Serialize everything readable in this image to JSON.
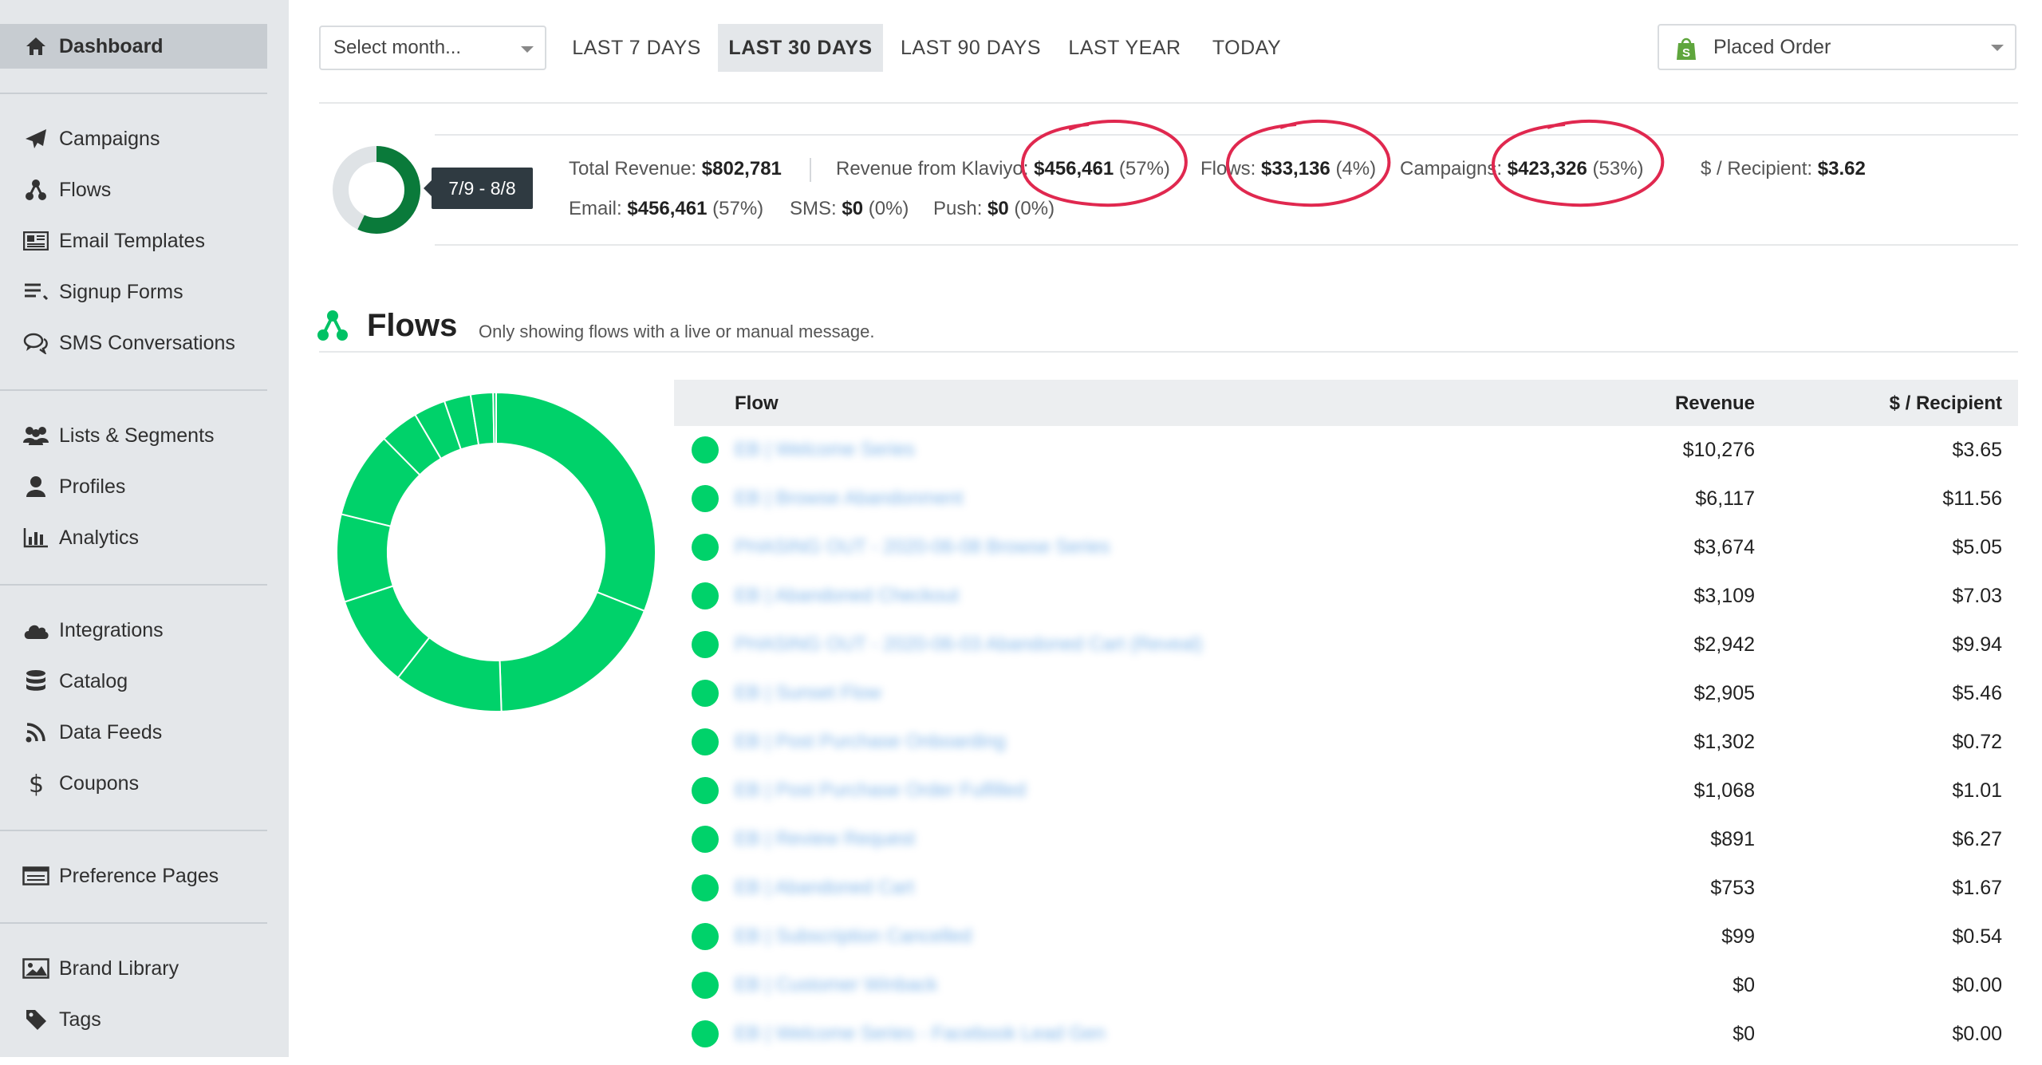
{
  "sidebar": {
    "active": {
      "label": "Dashboard",
      "icon": "home-icon"
    },
    "groups": [
      [
        {
          "label": "Campaigns",
          "icon": "paper-plane-icon"
        },
        {
          "label": "Flows",
          "icon": "flows-icon"
        },
        {
          "label": "Email Templates",
          "icon": "newspaper-icon"
        },
        {
          "label": "Signup Forms",
          "icon": "list-icon"
        },
        {
          "label": "SMS Conversations",
          "icon": "chat-icon"
        }
      ],
      [
        {
          "label": "Lists & Segments",
          "icon": "users-icon"
        },
        {
          "label": "Profiles",
          "icon": "user-icon"
        },
        {
          "label": "Analytics",
          "icon": "bar-chart-icon"
        }
      ],
      [
        {
          "label": "Integrations",
          "icon": "cloud-icon"
        },
        {
          "label": "Catalog",
          "icon": "database-icon"
        },
        {
          "label": "Data Feeds",
          "icon": "rss-icon"
        },
        {
          "label": "Coupons",
          "icon": "dollar-icon"
        }
      ],
      [
        {
          "label": "Preference Pages",
          "icon": "browser-window-icon"
        }
      ],
      [
        {
          "label": "Brand Library",
          "icon": "image-icon"
        },
        {
          "label": "Tags",
          "icon": "tag-icon"
        }
      ]
    ]
  },
  "toolbar": {
    "month_placeholder": "Select month...",
    "ranges": [
      "LAST 7 DAYS",
      "LAST 30 DAYS",
      "LAST 90 DAYS",
      "LAST YEAR",
      "TODAY"
    ],
    "active_range": "LAST 30 DAYS",
    "metric": "Placed Order"
  },
  "summary": {
    "date_range": "7/9 - 8/8",
    "total_revenue_label": "Total Revenue:",
    "total_revenue": "$802,781",
    "klaviyo_label": "Revenue from Klaviyo:",
    "klaviyo_value": "$456,461",
    "klaviyo_pct": "(57%)",
    "flows_label": "Flows:",
    "flows_value": "$33,136",
    "flows_pct": "(4%)",
    "campaigns_label": "Campaigns:",
    "campaigns_value": "$423,326",
    "campaigns_pct": "(53%)",
    "per_recipient_label": "$ / Recipient:",
    "per_recipient": "$3.62",
    "email_label": "Email:",
    "email_value": "$456,461",
    "email_pct": "(57%)",
    "sms_label": "SMS:",
    "sms_value": "$0",
    "sms_pct": "(0%)",
    "push_label": "Push:",
    "push_value": "$0",
    "push_pct": "(0%)",
    "klaviyo_share": 0.57
  },
  "flows_section": {
    "title": "Flows",
    "subtitle": "Only showing flows with a live or manual message.",
    "columns": {
      "flow": "Flow",
      "revenue": "Revenue",
      "per_recipient": "$ / Recipient"
    },
    "rows": [
      {
        "name": "EB | Welcome Series",
        "revenue": "$10,276",
        "per_recipient": "$3.65",
        "value": 10276
      },
      {
        "name": "EB | Browse Abandonment",
        "revenue": "$6,117",
        "per_recipient": "$11.56",
        "value": 6117
      },
      {
        "name": "PHASING OUT - 2020-06-08 Browse Series",
        "revenue": "$3,674",
        "per_recipient": "$5.05",
        "value": 3674
      },
      {
        "name": "EB | Abandoned Checkout",
        "revenue": "$3,109",
        "per_recipient": "$7.03",
        "value": 3109
      },
      {
        "name": "PHASING OUT - 2020-06-03 Abandoned Cart (Reveal)",
        "revenue": "$2,942",
        "per_recipient": "$9.94",
        "value": 2942
      },
      {
        "name": "EB | Sunset Flow",
        "revenue": "$2,905",
        "per_recipient": "$5.46",
        "value": 2905
      },
      {
        "name": "EB | Post Purchase Onboarding",
        "revenue": "$1,302",
        "per_recipient": "$0.72",
        "value": 1302
      },
      {
        "name": "EB | Post Purchase Order Fulfilled",
        "revenue": "$1,068",
        "per_recipient": "$1.01",
        "value": 1068
      },
      {
        "name": "EB | Review Request",
        "revenue": "$891",
        "per_recipient": "$6.27",
        "value": 891
      },
      {
        "name": "EB | Abandoned Cart",
        "revenue": "$753",
        "per_recipient": "$1.67",
        "value": 753
      },
      {
        "name": "EB | Subscription Cancelled",
        "revenue": "$99",
        "per_recipient": "$0.54",
        "value": 99
      },
      {
        "name": "EB | Customer Winback",
        "revenue": "$0",
        "per_recipient": "$0.00",
        "value": 0
      },
      {
        "name": "EB | Welcome Series - Facebook Lead Gen",
        "revenue": "$0",
        "per_recipient": "$0.00",
        "value": 0
      }
    ]
  },
  "colors": {
    "brand_green": "#00d26a",
    "dark_green": "#0a7a3a",
    "annotation_red": "#e0284f",
    "sidebar_bg": "#e4e7ea"
  }
}
